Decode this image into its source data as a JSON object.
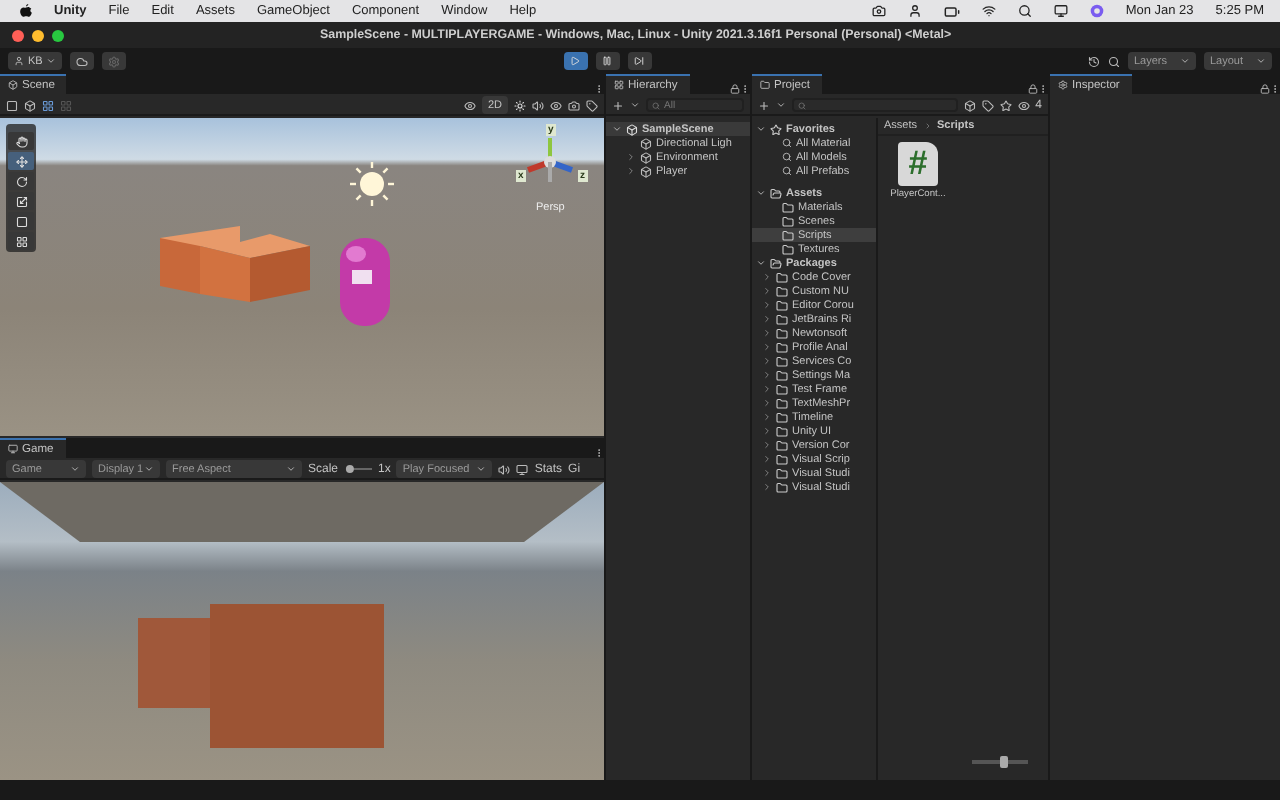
{
  "menubar": {
    "app": "Unity",
    "menus": [
      "File",
      "Edit",
      "Assets",
      "GameObject",
      "Component",
      "Window",
      "Help"
    ],
    "date": "Mon Jan 23",
    "time": "5:25 PM"
  },
  "window": {
    "title": "SampleScene - MULTIPLAYERGAME - Windows, Mac, Linux - Unity 2021.3.16f1 Personal (Personal) <Metal>"
  },
  "toolbar": {
    "account": "KB",
    "play_controls": [
      {
        "kind": "play",
        "selected": true
      },
      {
        "kind": "pause",
        "selected": false
      },
      {
        "kind": "step",
        "selected": false
      }
    ],
    "layers": "Layers",
    "layout": "Layout"
  },
  "scene": {
    "tab": "Scene",
    "mode_2d": "2D",
    "tools": [
      {
        "kind": "hand",
        "selected": false
      },
      {
        "kind": "move",
        "selected": true
      },
      {
        "kind": "rotate",
        "selected": false
      },
      {
        "kind": "scale",
        "selected": false
      },
      {
        "kind": "rect",
        "selected": false
      },
      {
        "kind": "transform",
        "selected": false
      }
    ],
    "axes": [
      "y",
      "x",
      "z"
    ],
    "projection": "Persp"
  },
  "game": {
    "tab": "Game",
    "view": "Game",
    "display": "Display 1",
    "aspect": "Free Aspect",
    "scale_label": "Scale",
    "scale_slider": {
      "level": 0.05
    },
    "scale_value": "1x",
    "play_mode": "Play Focused",
    "stats": "Stats",
    "gizmos": "Gi"
  },
  "hierarchy": {
    "tab": "Hierarchy",
    "placeholder": "All",
    "scene": "SampleScene",
    "items": [
      {
        "name": "Directional Ligh",
        "expandable": false
      },
      {
        "name": "Environment",
        "expandable": true
      },
      {
        "name": "Player",
        "expandable": true
      }
    ]
  },
  "project": {
    "tab": "Project",
    "count": "4",
    "favorites": {
      "label": "Favorites",
      "items": [
        "All Material",
        "All Models",
        "All Prefabs"
      ]
    },
    "folders": [
      {
        "name": "Assets",
        "children": [
          {
            "name": "Materials",
            "selected": false
          },
          {
            "name": "Scenes",
            "selected": false
          },
          {
            "name": "Scripts",
            "selected": true
          },
          {
            "name": "Textures",
            "selected": false
          }
        ]
      },
      {
        "name": "Packages",
        "children": [
          {
            "name": "Code Cover",
            "selected": false
          },
          {
            "name": "Custom NU",
            "selected": false
          },
          {
            "name": "Editor Corou",
            "selected": false
          },
          {
            "name": "JetBrains Ri",
            "selected": false
          },
          {
            "name": "Newtonsoft",
            "selected": false
          },
          {
            "name": "Profile Anal",
            "selected": false
          },
          {
            "name": "Services Co",
            "selected": false
          },
          {
            "name": "Settings Ma",
            "selected": false
          },
          {
            "name": "Test Frame",
            "selected": false
          },
          {
            "name": "TextMeshPr",
            "selected": false
          },
          {
            "name": "Timeline",
            "selected": false
          },
          {
            "name": "Unity UI",
            "selected": false
          },
          {
            "name": "Version Cor",
            "selected": false
          },
          {
            "name": "Visual Scrip",
            "selected": false
          },
          {
            "name": "Visual Studi",
            "selected": false
          },
          {
            "name": "Visual Studi",
            "selected": false
          }
        ]
      }
    ],
    "breadcrumb": [
      "Assets",
      "Scripts"
    ],
    "files": [
      {
        "name": "PlayerCont...",
        "glyph": "#"
      }
    ],
    "zoom_slider": {
      "level": 0.6
    }
  },
  "inspector": {
    "tab": "Inspector"
  }
}
